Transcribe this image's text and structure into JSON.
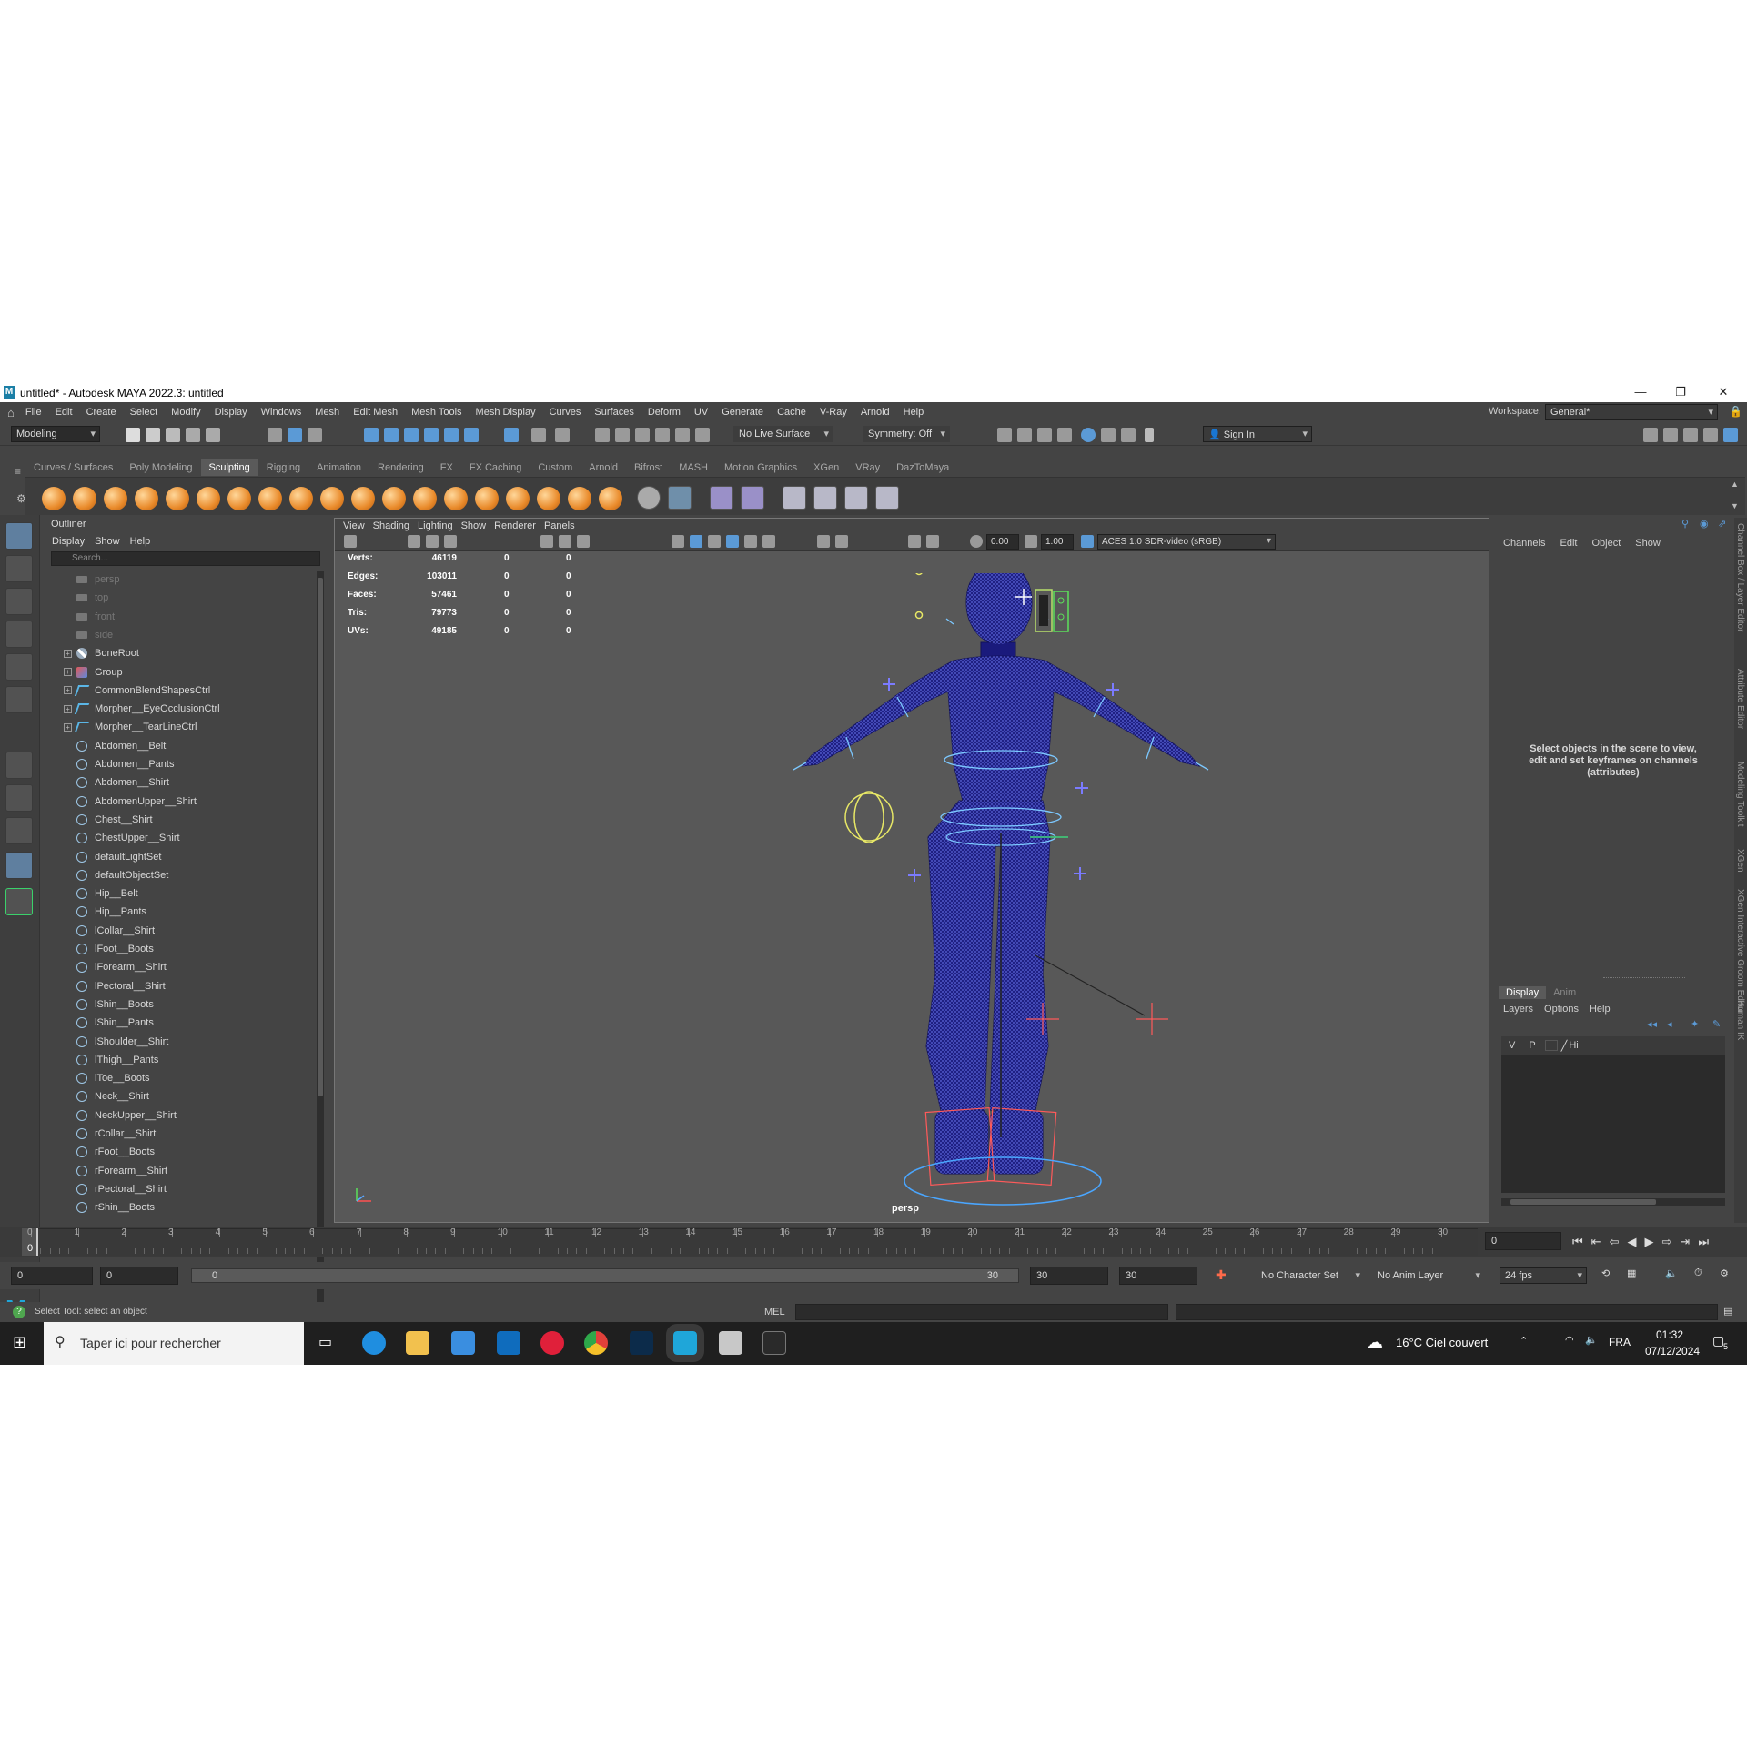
{
  "window": {
    "title": "untitled* - Autodesk MAYA 2022.3: untitled",
    "minimize": "—",
    "restore": "❐",
    "close": "✕"
  },
  "menu": [
    "File",
    "Edit",
    "Create",
    "Select",
    "Modify",
    "Display",
    "Windows",
    "Mesh",
    "Edit Mesh",
    "Mesh Tools",
    "Mesh Display",
    "Curves",
    "Surfaces",
    "Deform",
    "UV",
    "Generate",
    "Cache",
    "V-Ray",
    "Arnold",
    "Help"
  ],
  "workspace": {
    "label": "Workspace:",
    "value": "General*"
  },
  "status": {
    "mode": "Modeling",
    "live_surface": "No Live Surface",
    "symmetry": "Symmetry: Off",
    "sign_in": "Sign In"
  },
  "shelf_tabs": [
    "Curves / Surfaces",
    "Poly Modeling",
    "Sculpting",
    "Rigging",
    "Animation",
    "Rendering",
    "FX",
    "FX Caching",
    "Custom",
    "Arnold",
    "Bifrost",
    "MASH",
    "Motion Graphics",
    "XGen",
    "VRay",
    "DazToMaya"
  ],
  "shelf_active": "Sculpting",
  "outliner": {
    "title": "Outliner",
    "menu": [
      "Display",
      "Show",
      "Help"
    ],
    "search_placeholder": "Search...",
    "items": [
      {
        "label": "persp",
        "type": "camera"
      },
      {
        "label": "top",
        "type": "camera"
      },
      {
        "label": "front",
        "type": "camera"
      },
      {
        "label": "side",
        "type": "camera"
      },
      {
        "label": "BoneRoot",
        "type": "joint"
      },
      {
        "label": "Group",
        "type": "group"
      },
      {
        "label": "CommonBlendShapesCtrl",
        "type": "curve"
      },
      {
        "label": "Morpher__EyeOcclusionCtrl",
        "type": "curve"
      },
      {
        "label": "Morpher__TearLineCtrl",
        "type": "curve"
      },
      {
        "label": "Abdomen__Belt",
        "type": "set"
      },
      {
        "label": "Abdomen__Pants",
        "type": "set"
      },
      {
        "label": "Abdomen__Shirt",
        "type": "set"
      },
      {
        "label": "AbdomenUpper__Shirt",
        "type": "set"
      },
      {
        "label": "Chest__Shirt",
        "type": "set"
      },
      {
        "label": "ChestUpper__Shirt",
        "type": "set"
      },
      {
        "label": "defaultLightSet",
        "type": "set"
      },
      {
        "label": "defaultObjectSet",
        "type": "set"
      },
      {
        "label": "Hip__Belt",
        "type": "set"
      },
      {
        "label": "Hip__Pants",
        "type": "set"
      },
      {
        "label": "lCollar__Shirt",
        "type": "set"
      },
      {
        "label": "lFoot__Boots",
        "type": "set"
      },
      {
        "label": "lForearm__Shirt",
        "type": "set"
      },
      {
        "label": "lPectoral__Shirt",
        "type": "set"
      },
      {
        "label": "lShin__Boots",
        "type": "set"
      },
      {
        "label": "lShin__Pants",
        "type": "set"
      },
      {
        "label": "lShoulder__Shirt",
        "type": "set"
      },
      {
        "label": "lThigh__Pants",
        "type": "set"
      },
      {
        "label": "lToe__Boots",
        "type": "set"
      },
      {
        "label": "Neck__Shirt",
        "type": "set"
      },
      {
        "label": "NeckUpper__Shirt",
        "type": "set"
      },
      {
        "label": "rCollar__Shirt",
        "type": "set"
      },
      {
        "label": "rFoot__Boots",
        "type": "set"
      },
      {
        "label": "rForearm__Shirt",
        "type": "set"
      },
      {
        "label": "rPectoral__Shirt",
        "type": "set"
      },
      {
        "label": "rShin__Boots",
        "type": "set"
      }
    ]
  },
  "viewport": {
    "menu": [
      "View",
      "Shading",
      "Lighting",
      "Show",
      "Renderer",
      "Panels"
    ],
    "exposure": "0.00",
    "gamma": "1.00",
    "color_space": "ACES 1.0 SDR-video (sRGB)",
    "camera": "persp",
    "stats": [
      {
        "label": "Verts:",
        "v1": "46119",
        "v2": "0",
        "v3": "0"
      },
      {
        "label": "Edges:",
        "v1": "103011",
        "v2": "0",
        "v3": "0"
      },
      {
        "label": "Faces:",
        "v1": "57461",
        "v2": "0",
        "v3": "0"
      },
      {
        "label": "Tris:",
        "v1": "79773",
        "v2": "0",
        "v3": "0"
      },
      {
        "label": "UVs:",
        "v1": "49185",
        "v2": "0",
        "v3": "0"
      }
    ]
  },
  "channel_box": {
    "menu": [
      "Channels",
      "Edit",
      "Object",
      "Show"
    ],
    "hint": "Select objects in the scene to view, edit and set keyframes on channels (attributes)",
    "layer_tabs": [
      "Display",
      "Anim"
    ],
    "layer_menu": [
      "Layers",
      "Options",
      "Help"
    ],
    "layer_row": {
      "v": "V",
      "p": "P",
      "name": "Hi"
    }
  },
  "side_tabs": [
    "Channel Box / Layer Editor",
    "Attribute Editor",
    "Modeling Toolkit",
    "XGen",
    "XGen Interactive Groom Editor",
    "Human IK"
  ],
  "timeline": {
    "ticks": [
      "0",
      "1",
      "2",
      "3",
      "4",
      "5",
      "6",
      "7",
      "8",
      "9",
      "10",
      "11",
      "12",
      "13",
      "14",
      "15",
      "16",
      "17",
      "18",
      "19",
      "20",
      "21",
      "22",
      "23",
      "24",
      "25",
      "26",
      "27",
      "28",
      "29",
      "30"
    ],
    "current_frame_marker": "0",
    "current_frame": "0"
  },
  "range": {
    "start": "0",
    "anim_start": "0",
    "slider_left": "0",
    "slider_right": "30",
    "anim_end": "30",
    "end": "30",
    "character_set": "No Character Set",
    "anim_layer": "No Anim Layer",
    "fps": "24 fps"
  },
  "command": {
    "help_text": "Select Tool: select an object",
    "lang": "MEL"
  },
  "taskbar": {
    "search_placeholder": "Taper ici pour rechercher",
    "weather": "16°C  Ciel couvert",
    "lang": "FRA",
    "time": "01:32",
    "date": "07/12/2024",
    "notifications": "5"
  }
}
